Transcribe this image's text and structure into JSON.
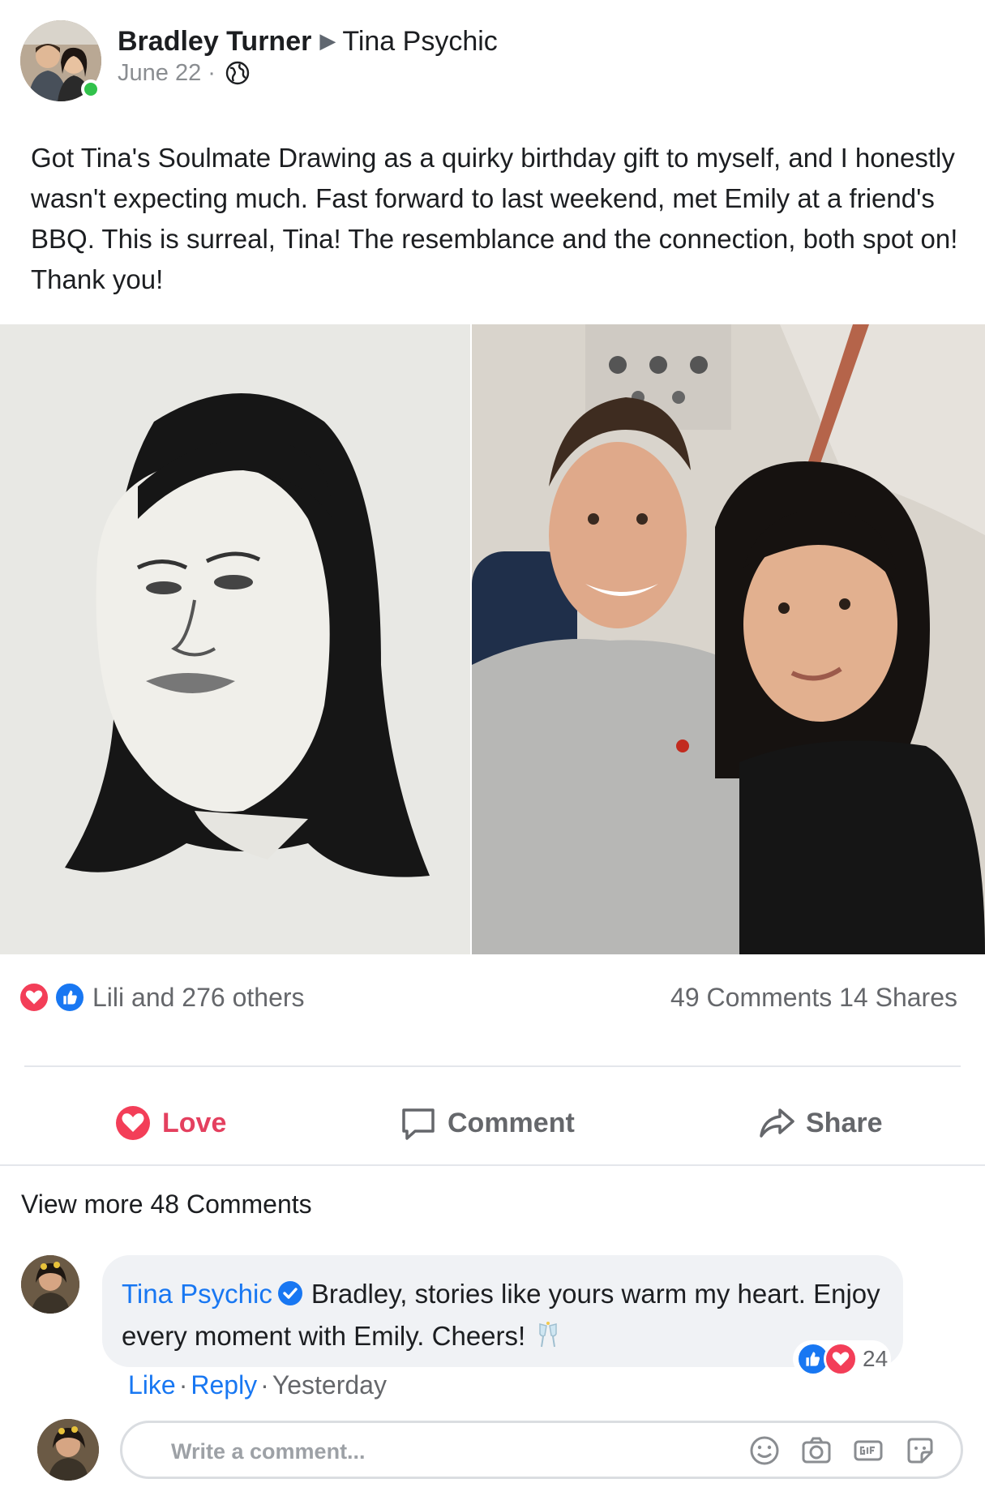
{
  "post": {
    "author": "Bradley Turner",
    "page": "Tina Psychic",
    "date": "June 22",
    "separator": "·",
    "text": "Got Tina's Soulmate Drawing as a quirky birthday gift to myself, and I honestly wasn't expecting much. Fast forward to last weekend, met Emily at a friend's BBQ. This is surreal, Tina! The resemblance and the connection, both spot on! Thank you!"
  },
  "engagement": {
    "reactions_summary": "Lili and 276 others",
    "comments_shares": "49 Comments 14 Shares"
  },
  "actions": {
    "love": "Love",
    "comment": "Comment",
    "share": "Share"
  },
  "comments": {
    "view_more": "View more 48 Comments",
    "items": [
      {
        "name": "Tina Psychic",
        "text": "Bradley, stories like yours warm my heart. Enjoy every moment with Emily. Cheers!",
        "reaction_count": "24",
        "like": "Like",
        "reply": "Reply",
        "time": "Yesterday",
        "separator": "·"
      }
    ]
  },
  "composer": {
    "placeholder": "Write a comment..."
  },
  "colors": {
    "link_blue": "#1877f2",
    "love_red": "#f33e58",
    "online_green": "#31c24b",
    "muted_text": "#65676b"
  },
  "icons": [
    "globe-icon",
    "play-arrow-icon",
    "love-icon",
    "like-icon",
    "comment-icon",
    "share-icon",
    "verified-icon",
    "cheers-icon",
    "emoji-icon",
    "camera-icon",
    "gif-icon",
    "sticker-icon"
  ]
}
